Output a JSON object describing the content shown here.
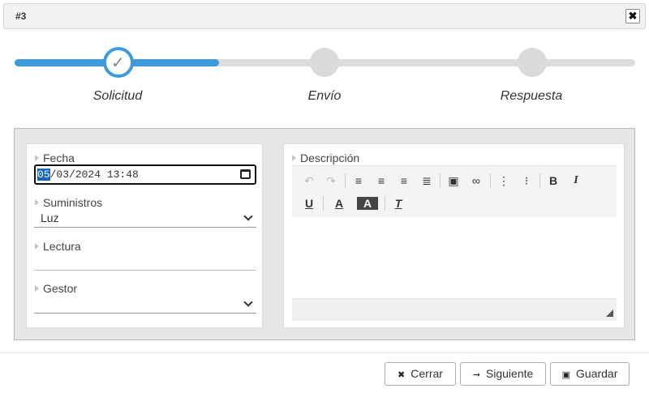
{
  "dialog": {
    "title": "#3",
    "close_glyph": "✖"
  },
  "wizard": {
    "progress": 0.33,
    "steps": [
      {
        "label": "Solicitud",
        "state": "done"
      },
      {
        "label": "Envío",
        "state": "pending"
      },
      {
        "label": "Respuesta",
        "state": "pending"
      }
    ],
    "check_glyph": "✓",
    "accent_color": "#3d9bdb"
  },
  "form": {
    "fecha": {
      "label": "Fecha",
      "day": "05",
      "rest": "/03/2024 13:48",
      "icon": "calendar-icon"
    },
    "suministros": {
      "label": "Suministros",
      "value": "Luz"
    },
    "lectura": {
      "label": "Lectura",
      "value": ""
    },
    "gestor": {
      "label": "Gestor",
      "value": ""
    }
  },
  "editor": {
    "label": "Descripción",
    "tools": [
      {
        "name": "undo-icon",
        "glyph": "↶"
      },
      {
        "name": "redo-icon",
        "glyph": "↷"
      },
      {
        "name": "align-left-icon",
        "glyph": "≡"
      },
      {
        "name": "align-center-icon",
        "glyph": "≡"
      },
      {
        "name": "align-right-icon",
        "glyph": "≡"
      },
      {
        "name": "align-justify-icon",
        "glyph": "≣"
      },
      {
        "name": "image-icon",
        "glyph": "▣"
      },
      {
        "name": "link-icon",
        "glyph": "∞"
      },
      {
        "name": "ordered-list-icon",
        "glyph": "⋮"
      },
      {
        "name": "bullet-list-icon",
        "glyph": "⁝"
      },
      {
        "name": "bold-icon",
        "glyph": "B"
      },
      {
        "name": "italic-icon",
        "glyph": "I"
      },
      {
        "name": "underline-icon",
        "glyph": "U"
      },
      {
        "name": "text-color-icon",
        "glyph": "A"
      },
      {
        "name": "background-color-icon",
        "glyph": "A"
      },
      {
        "name": "clear-format-icon",
        "glyph": "T"
      }
    ]
  },
  "footer": {
    "cerrar": {
      "label": "Cerrar",
      "icon_glyph": "✖"
    },
    "siguiente": {
      "label": "Siguiente",
      "icon_glyph": "➞"
    },
    "guardar": {
      "label": "Guardar",
      "icon_glyph": "▣"
    }
  }
}
